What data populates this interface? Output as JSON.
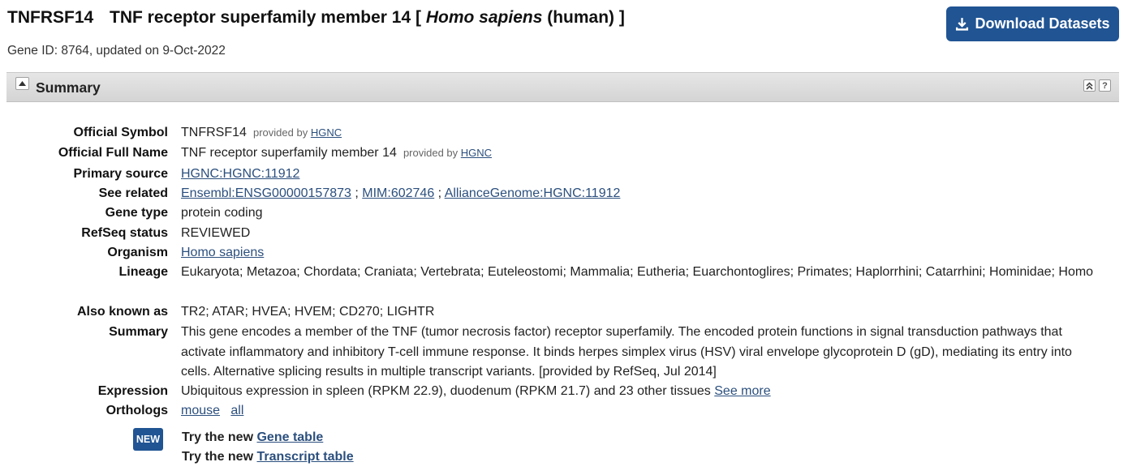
{
  "header": {
    "symbol": "TNFRSF14",
    "name_prefix": "TNF receptor superfamily member 14 [",
    "organism_italic": "Homo sapiens",
    "name_suffix": "(human) ]",
    "gene_id_line": "Gene ID: 8764, updated on 9-Oct-2022"
  },
  "download_button": {
    "label": "Download Datasets",
    "icon": "download-icon"
  },
  "section": {
    "title": "Summary",
    "help": "?"
  },
  "fields": {
    "official_symbol": {
      "label": "Official Symbol",
      "value": "TNFRSF14",
      "provided_by": "provided by",
      "provider": "HGNC"
    },
    "official_full_name": {
      "label": "Official Full Name",
      "value": "TNF receptor superfamily member 14",
      "provided_by": "provided by",
      "provider": "HGNC"
    },
    "primary_source": {
      "label": "Primary source",
      "link": "HGNC:HGNC:11912"
    },
    "see_related": {
      "label": "See related",
      "links": [
        "Ensembl:ENSG00000157873",
        "MIM:602746",
        "AllianceGenome:HGNC:11912"
      ],
      "sep": ";"
    },
    "gene_type": {
      "label": "Gene type",
      "value": "protein coding"
    },
    "refseq_status": {
      "label": "RefSeq status",
      "value": "REVIEWED"
    },
    "organism": {
      "label": "Organism",
      "link": "Homo sapiens"
    },
    "lineage": {
      "label": "Lineage",
      "value": "Eukaryota; Metazoa; Chordata; Craniata; Vertebrata; Euteleostomi; Mammalia; Eutheria; Euarchontoglires; Primates; Haplorrhini; Catarrhini; Hominidae; Homo"
    },
    "also_known_as": {
      "label": "Also known as",
      "value": "TR2; ATAR; HVEA; HVEM; CD270; LIGHTR"
    },
    "summary": {
      "label": "Summary",
      "value": "This gene encodes a member of the TNF (tumor necrosis factor) receptor superfamily. The encoded protein functions in signal transduction pathways that activate inflammatory and inhibitory T-cell immune response. It binds herpes simplex virus (HSV) viral envelope glycoprotein D (gD), mediating its entry into cells. Alternative splicing results in multiple transcript variants. [provided by RefSeq, Jul 2014]"
    },
    "expression": {
      "label": "Expression",
      "value": "Ubiquitous expression in spleen (RPKM 22.9), duodenum (RPKM 21.7) and 23 other tissues",
      "link": "See more"
    },
    "orthologs": {
      "label": "Orthologs",
      "links": [
        "mouse",
        "all"
      ]
    }
  },
  "new_banner": {
    "badge": "NEW",
    "line1_prefix": "Try the new",
    "line1_link": "Gene table",
    "line2_prefix": "Try the new",
    "line2_link": "Transcript table"
  },
  "colors": {
    "button_blue": "#205493",
    "link": "#2b4f7e"
  }
}
